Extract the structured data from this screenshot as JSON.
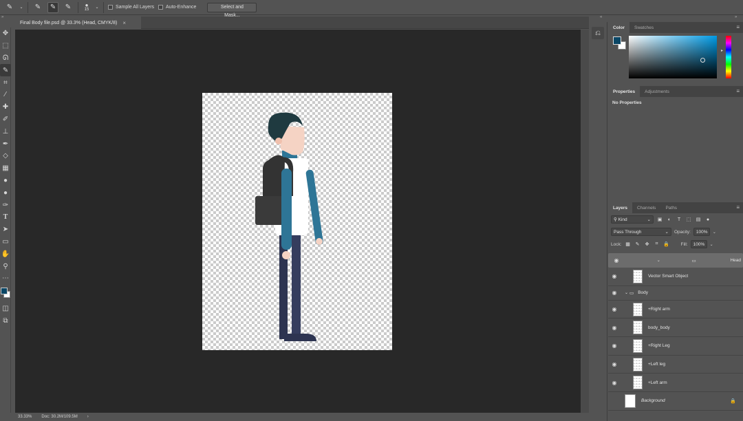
{
  "options_bar": {
    "brush_size": "15",
    "sample_all_layers_label": "Sample All Layers",
    "auto_enhance_label": "Auto-Enhance",
    "select_mask_label": "Select and Mask..."
  },
  "document": {
    "tab_title": "Final Body file.psd @ 33.3% (Head, CMYK/8)",
    "tab_close": "×",
    "zoom": "33.33%",
    "doc_info": "Doc: 30.2M/109.5M",
    "status_arrow": "›"
  },
  "tools": [
    "move-tool",
    "marquee-tool",
    "lasso-tool",
    "quick-selection-tool",
    "crop-tool",
    "eyedropper-tool",
    "healing-brush-tool",
    "brush-tool",
    "clone-stamp-tool",
    "history-brush-tool",
    "eraser-tool",
    "gradient-tool",
    "blur-tool",
    "dodge-tool",
    "pen-tool",
    "type-tool",
    "path-selection-tool",
    "rectangle-tool",
    "hand-tool",
    "zoom-tool",
    "more-tools"
  ],
  "color_panel": {
    "tabs": [
      "Color",
      "Swatches"
    ],
    "foreground_color": "#0b4766",
    "background_color": "#ffffff"
  },
  "properties_panel": {
    "tabs": [
      "Properties",
      "Adjustments"
    ],
    "message": "No Properties"
  },
  "layers_panel": {
    "tabs": [
      "Layers",
      "Channels",
      "Paths"
    ],
    "filter_kind": "Kind",
    "blend_mode": "Pass Through",
    "opacity_label": "Opacity:",
    "opacity_value": "100%",
    "lock_label": "Lock:",
    "fill_label": "Fill:",
    "fill_value": "100%",
    "layers": [
      {
        "name": "Head",
        "type": "group",
        "selected": true
      },
      {
        "name": "Vector Smart Object",
        "type": "layer"
      },
      {
        "name": "Body",
        "type": "group"
      },
      {
        "name": "+Right arm",
        "type": "layer"
      },
      {
        "name": "body_body",
        "type": "layer"
      },
      {
        "name": "+Right Leg",
        "type": "layer"
      },
      {
        "name": "+Left leg",
        "type": "layer"
      },
      {
        "name": "+Left arm",
        "type": "layer"
      },
      {
        "name": "Background",
        "type": "background",
        "locked": true
      }
    ]
  },
  "artwork": {
    "hair_color": "#1f3a40",
    "skin_color": "#f5d3c4",
    "shirt_color": "#ffffff",
    "sleeve_color": "#2e7596",
    "backpack_color": "#333333",
    "pants_color": "#2d3451"
  }
}
